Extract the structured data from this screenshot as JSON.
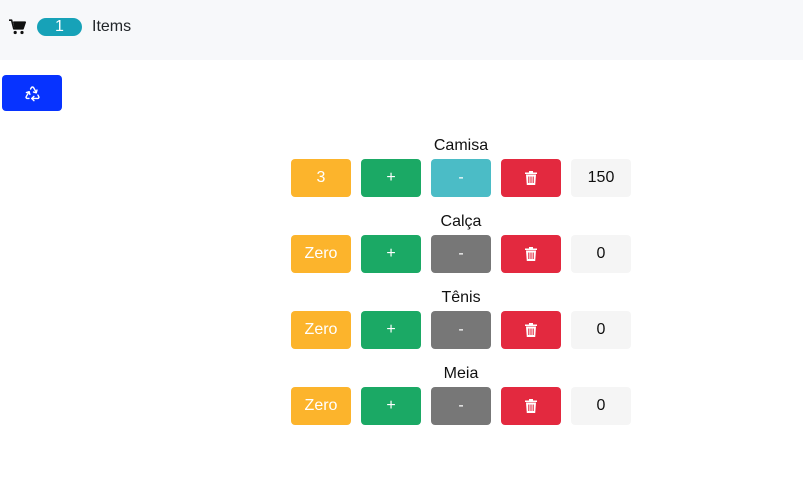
{
  "navbar": {
    "cart_icon": "shopping-cart-icon",
    "badge_count": "1",
    "items_label": "Items"
  },
  "reset_button": {
    "icon": "recycle-icon"
  },
  "colors": {
    "warning": "#fcb42c",
    "success": "#1ba965",
    "info": "#4bbcc6",
    "secondary": "#777777",
    "danger": "#e3293f",
    "primary": "#0733ff",
    "badge": "#17a2b8"
  },
  "products": [
    {
      "name": "Camisa",
      "quantity_label": "3",
      "plus_label": "+",
      "minus_label": "-",
      "delete_icon": "trash-icon",
      "value": "150",
      "minus_active": true
    },
    {
      "name": "Calça",
      "quantity_label": "Zero",
      "plus_label": "+",
      "minus_label": "-",
      "delete_icon": "trash-icon",
      "value": "0",
      "minus_active": false
    },
    {
      "name": "Tênis",
      "quantity_label": "Zero",
      "plus_label": "+",
      "minus_label": "-",
      "delete_icon": "trash-icon",
      "value": "0",
      "minus_active": false
    },
    {
      "name": "Meia",
      "quantity_label": "Zero",
      "plus_label": "+",
      "minus_label": "-",
      "delete_icon": "trash-icon",
      "value": "0",
      "minus_active": false
    }
  ]
}
